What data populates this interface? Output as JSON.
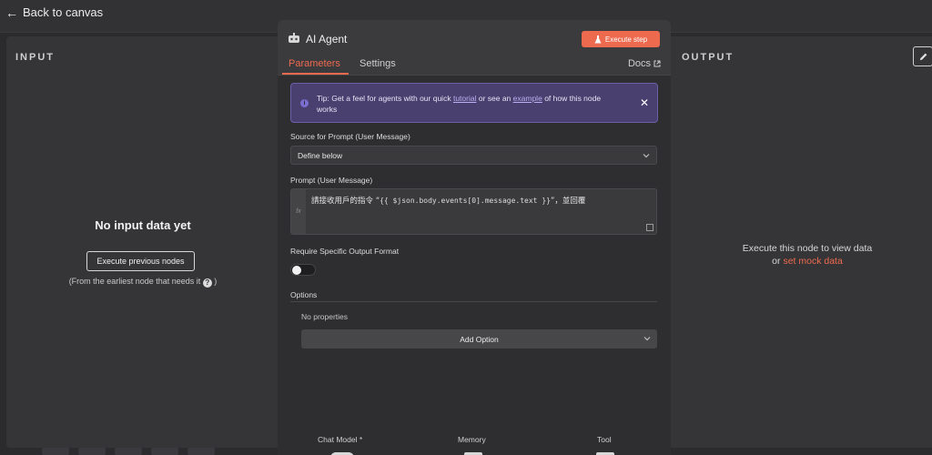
{
  "topbar": {
    "back_label": "Back to canvas"
  },
  "input_panel": {
    "title": "INPUT",
    "empty_title": "No input data yet",
    "execute_previous_label": "Execute previous nodes",
    "hint": "(From the earliest node that needs it",
    "hint_close": ")"
  },
  "output_panel": {
    "title": "OUTPUT",
    "message": "Execute this node to view data",
    "or_text": "or",
    "mock_link": "set mock data"
  },
  "node": {
    "title": "AI Agent",
    "execute_step_label": "Execute step",
    "tabs": [
      {
        "label": "Parameters",
        "active": true
      },
      {
        "label": "Settings",
        "active": false
      }
    ],
    "docs_label": "Docs",
    "tip": {
      "prefix": "Tip: Get a feel for agents with our quick",
      "tutorial_link": "tutorial",
      "middle": "or see an",
      "example_link": "example",
      "suffix": "of how this node works"
    },
    "source_label": "Source for Prompt (User Message)",
    "source_value": "Define below",
    "prompt_label": "Prompt (User Message)",
    "prompt_prefix": "請接收用戶的指令 “",
    "prompt_expression": "{{ $json.body.events[0].message.text }}",
    "prompt_suffix": "”，並回覆",
    "require_format_label": "Require Specific Output Format",
    "require_format_enabled": false,
    "options_label": "Options",
    "no_properties": "No properties",
    "add_option_label": "Add Option",
    "sub_nodes": [
      {
        "label": "Chat Model *"
      },
      {
        "label": "Memory"
      },
      {
        "label": "Tool"
      }
    ]
  },
  "colors": {
    "accent": "#ee6a4f",
    "tip_bg": "#4a4070"
  }
}
